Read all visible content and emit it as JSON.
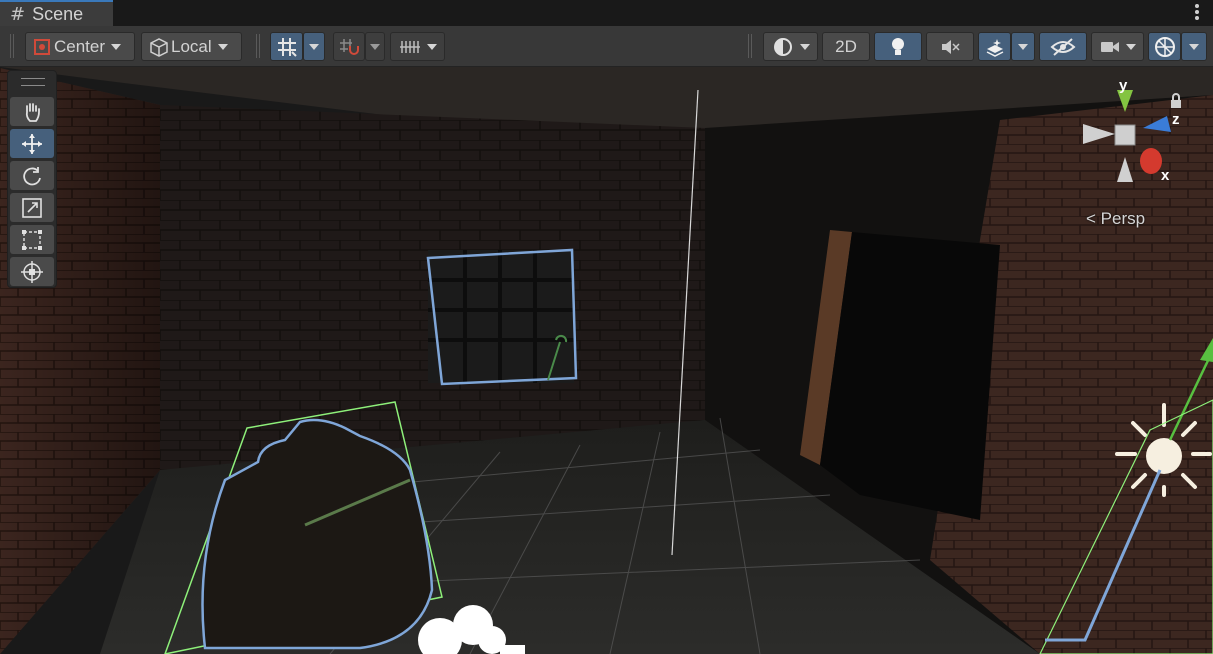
{
  "tab": {
    "title": "Scene",
    "icon": "hash-icon"
  },
  "toolbar": {
    "pivot_label": "Center",
    "space_label": "Local",
    "mode_2d_label": "2D"
  },
  "viewport": {
    "projection_label": "Persp",
    "axis_y": "y",
    "axis_z": "z",
    "axis_x": "x"
  },
  "tools": [
    {
      "name": "hand-tool",
      "icon": "hand-icon"
    },
    {
      "name": "move-tool",
      "icon": "move-icon",
      "active": true
    },
    {
      "name": "rotate-tool",
      "icon": "rotate-icon"
    },
    {
      "name": "scale-tool",
      "icon": "scale-icon"
    },
    {
      "name": "rect-tool",
      "icon": "rect-icon"
    },
    {
      "name": "transform-tool",
      "icon": "transform-icon"
    }
  ],
  "colors": {
    "accent": "#46607c",
    "tab_highlight": "#3a79bb",
    "selection_outline": "#7fa6d8",
    "bounds": "#8ef07a"
  }
}
